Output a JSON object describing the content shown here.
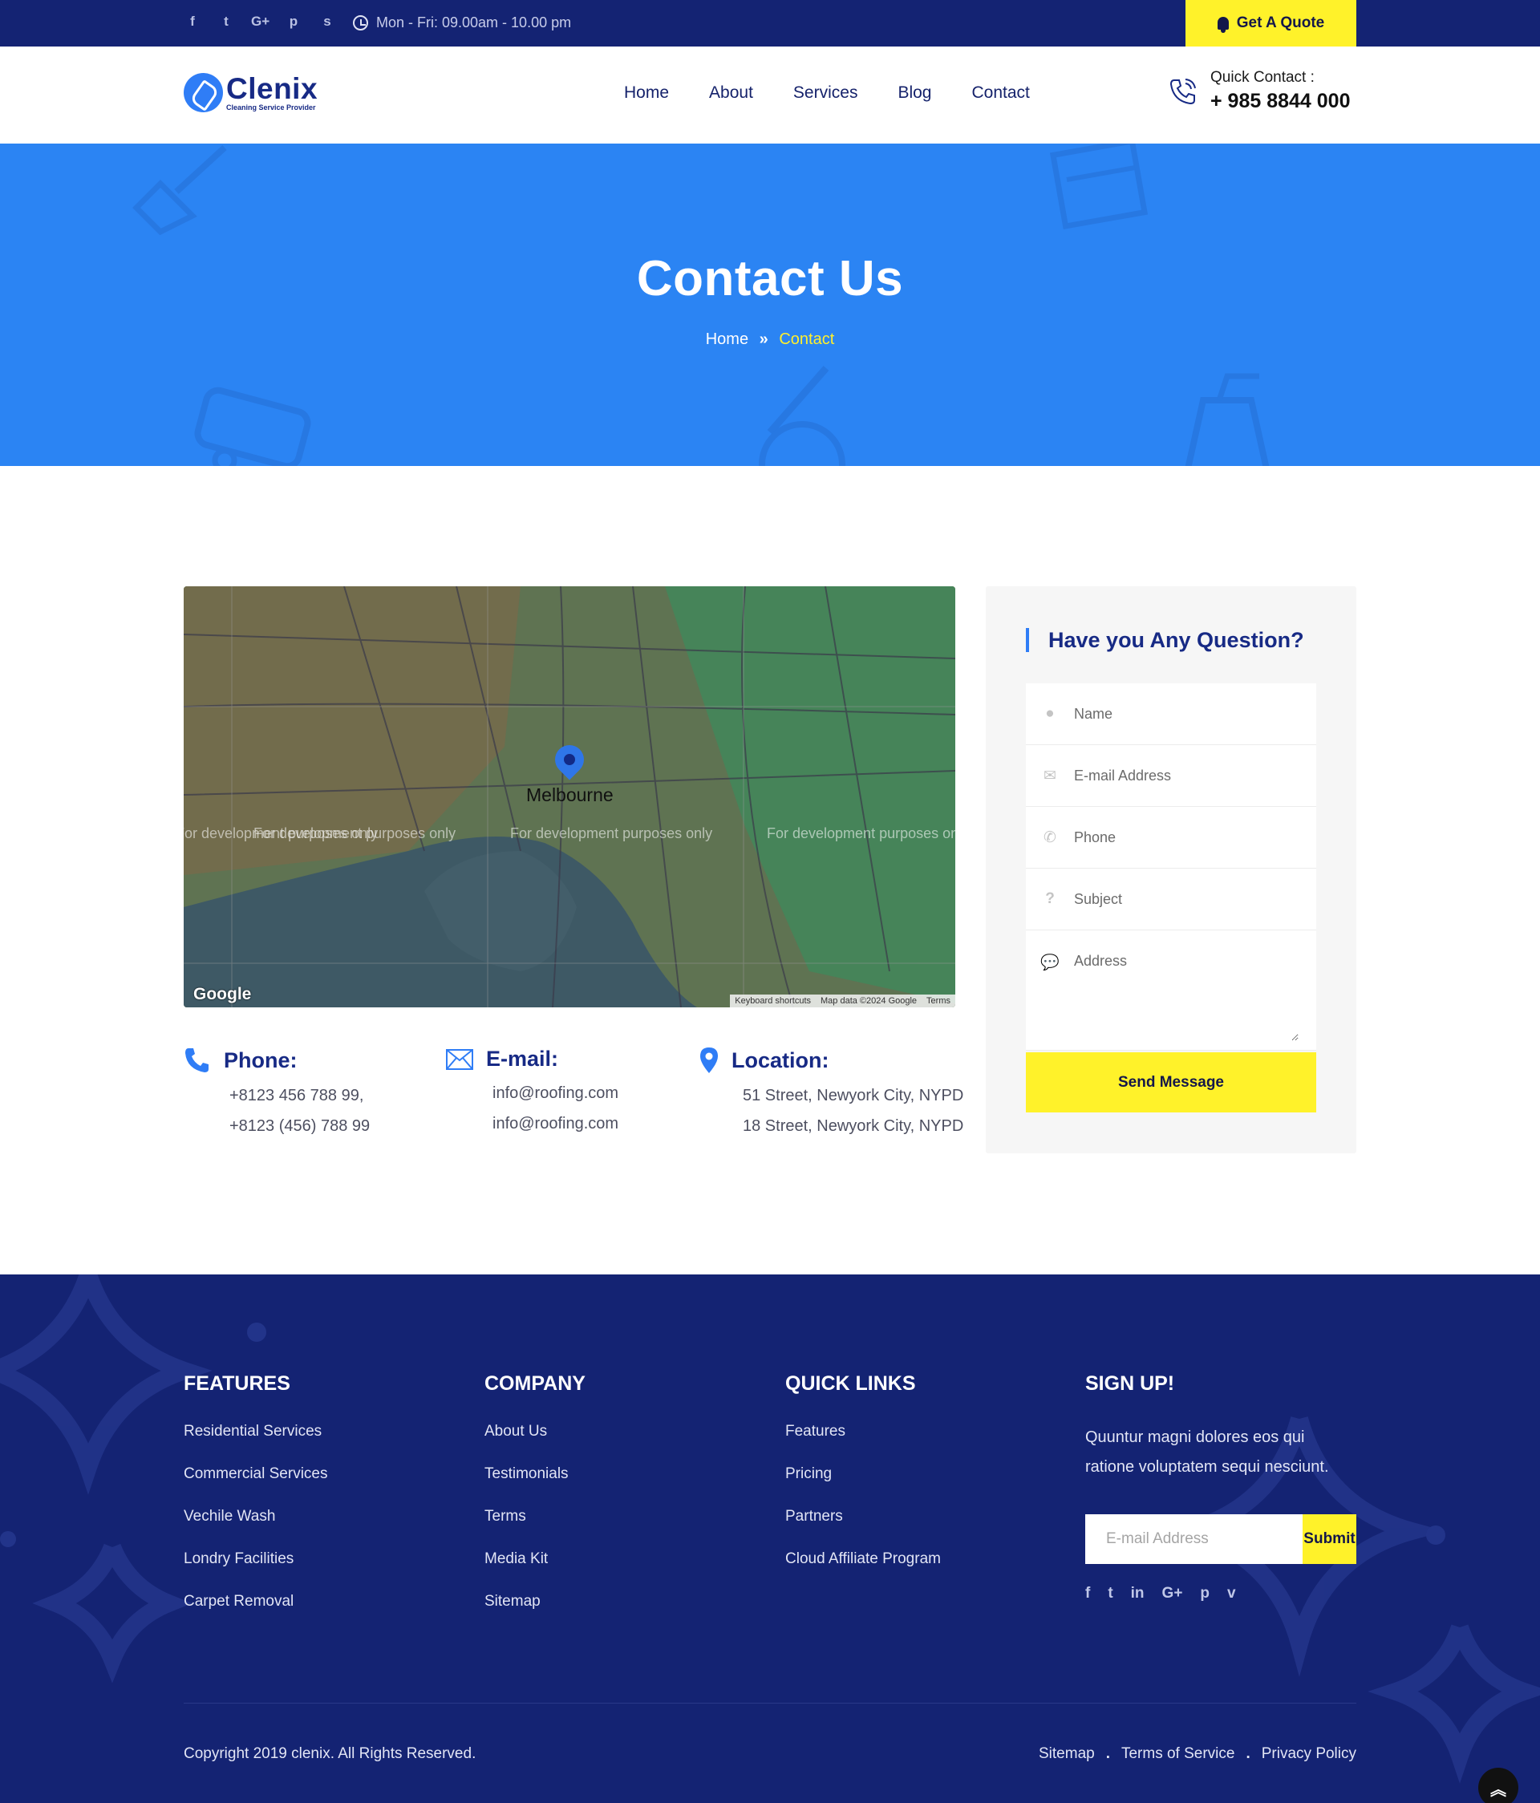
{
  "topbar": {
    "social_icons": [
      "facebook-icon",
      "twitter-icon",
      "google-plus-icon",
      "pinterest-icon",
      "snapchat-icon"
    ],
    "social_glyphs": [
      "f",
      "t",
      "G+",
      "p",
      "s"
    ],
    "hours": "Mon - Fri: 09.00am - 10.00 pm",
    "quote_label": "Get A Quote"
  },
  "header": {
    "logo_name": "Clenix",
    "logo_tagline": "Cleaning Service Provider",
    "nav": [
      "Home",
      "About",
      "Services",
      "Blog",
      "Contact"
    ],
    "quick_label": "Quick Contact :",
    "quick_phone": "+ 985 8844 000"
  },
  "hero": {
    "title": "Contact Us",
    "breadcrumb_home": "Home",
    "breadcrumb_sep": "»",
    "breadcrumb_current": "Contact"
  },
  "map": {
    "city": "Melbourne",
    "dev_text": "For development purposes only",
    "google": "Google",
    "attribution": [
      "Keyboard shortcuts",
      "Map data ©2024 Google",
      "Terms"
    ]
  },
  "contact_info": {
    "phone": {
      "title": "Phone:",
      "lines": [
        "+8123 456 788 99,",
        "+8123 (456) 788 99"
      ]
    },
    "email": {
      "title": "E-mail:",
      "lines": [
        "info@roofing.com",
        "info@roofing.com"
      ]
    },
    "location": {
      "title": "Location:",
      "lines": [
        "51 Street, Newyork City, NYPD",
        "18 Street, Newyork City, NYPD"
      ]
    }
  },
  "form": {
    "title": "Have you Any Question?",
    "name_placeholder": "Name",
    "email_placeholder": "E-mail Address",
    "phone_placeholder": "Phone",
    "subject_placeholder": "Subject",
    "address_placeholder": "Address",
    "submit_label": "Send Message"
  },
  "footer": {
    "features": {
      "title": "FEATURES",
      "links": [
        "Residential Services",
        "Commercial Services",
        "Vechile Wash",
        "Londry Facilities",
        "Carpet Removal"
      ]
    },
    "company": {
      "title": "COMPANY",
      "links": [
        "About Us",
        "Testimonials",
        "Terms",
        "Media Kit",
        "Sitemap"
      ]
    },
    "quick_links": {
      "title": "QUICK LINKS",
      "links": [
        "Features",
        "Pricing",
        "Partners",
        "Cloud Affiliate Program"
      ]
    },
    "signup": {
      "title": "SIGN UP!",
      "text": "Quuntur magni dolores eos qui ratione voluptatem sequi nesciunt.",
      "email_placeholder": "E-mail Address",
      "submit_label": "Submit",
      "social_icons": [
        "facebook-icon",
        "twitter-icon",
        "linkedin-icon",
        "google-plus-icon",
        "pinterest-icon",
        "vimeo-icon"
      ],
      "social_glyphs": [
        "f",
        "t",
        "in",
        "G+",
        "p",
        "v"
      ]
    },
    "copyright": "Copyright 2019 clenix. All Rights Reserved.",
    "bottom_links": [
      "Sitemap",
      "Terms of Service",
      "Privacy Policy"
    ],
    "link_sep": "."
  },
  "colors": {
    "navy": "#142373",
    "blue": "#2b84f3",
    "yellow": "#fff22a",
    "heading": "#172a85"
  }
}
